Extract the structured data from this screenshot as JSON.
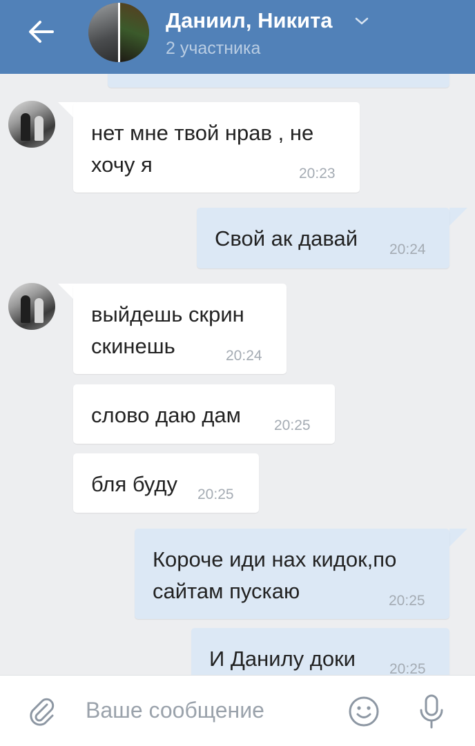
{
  "header": {
    "title": "Даниил, Никита",
    "subtitle": "2 участника"
  },
  "messages": [
    {
      "direction": "in",
      "text": "нет мне твой нрав , не\nхочу я",
      "time": "20:23"
    },
    {
      "direction": "out",
      "text": "Свой ак давай",
      "time": "20:24"
    },
    {
      "direction": "in",
      "text": "выйдешь скрин\nскинешь",
      "time": "20:24"
    },
    {
      "direction": "in",
      "text": "слово даю дам",
      "time": "20:25"
    },
    {
      "direction": "in",
      "text": "бля буду",
      "time": "20:25"
    },
    {
      "direction": "out",
      "text": "Короче иди нах кидок,по\nсайтам пускаю",
      "time": "20:25"
    },
    {
      "direction": "out",
      "text": "И Данилу доки",
      "time": "20:25"
    }
  ],
  "composer": {
    "placeholder": "Ваше сообщение"
  },
  "colors": {
    "header_bg": "#5181b8",
    "outgoing_bubble": "#dce8f5",
    "incoming_bubble": "#ffffff",
    "chat_bg": "#edeef0"
  }
}
